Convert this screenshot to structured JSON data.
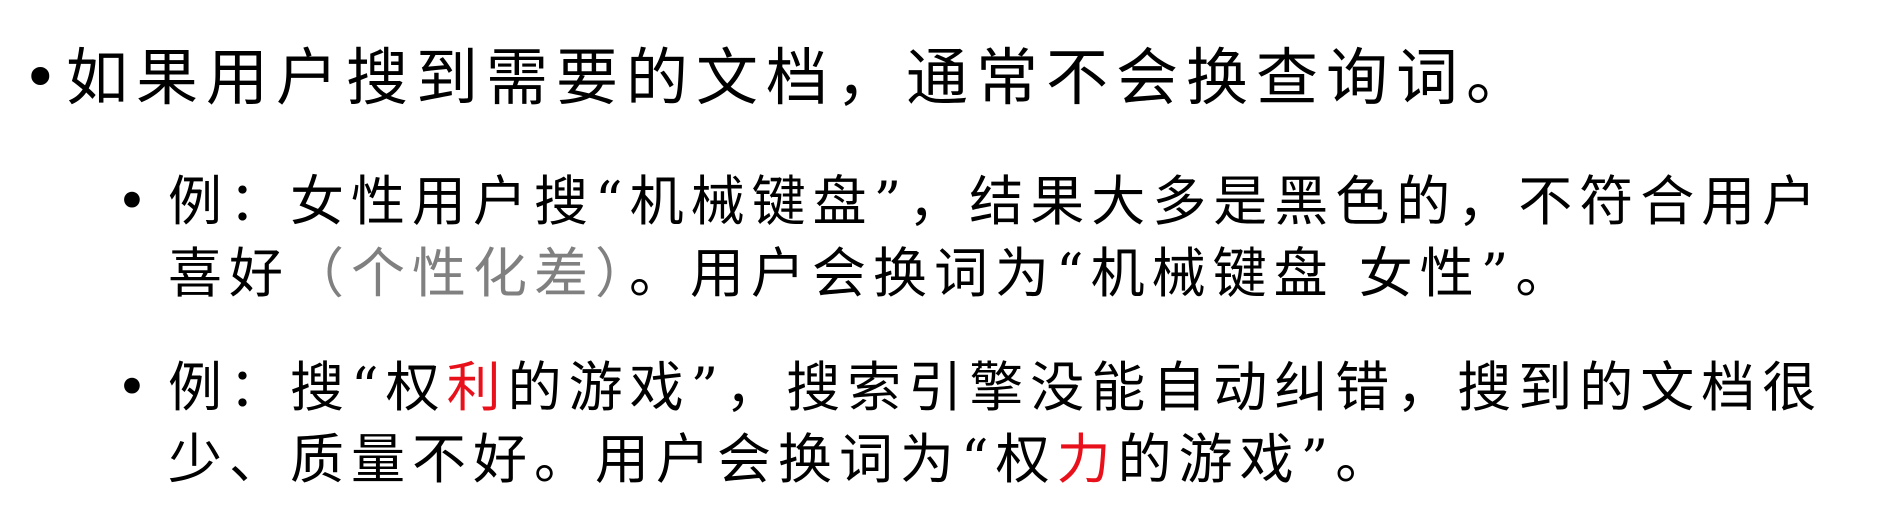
{
  "main_point": "如果用户搜到需要的文档，通常不会换查询词。",
  "examples": [
    {
      "part1": "例：女性用户搜“机械键盘”，结果大多是黑色的，不符合用户喜好",
      "muted": "（个性化差）",
      "part2": "。用户会换词为“机械键盘 女性”。"
    },
    {
      "part1": "例：搜“权",
      "highlight1": "利",
      "part2": "的游戏”，搜索引擎没能自动纠错，搜到的文档很少、质量不好。用户会换词为“权",
      "highlight2": "力",
      "part3": "的游戏”。"
    }
  ],
  "colors": {
    "text": "#000000",
    "muted": "#808080",
    "highlight": "#e8101a"
  },
  "bullet_glyph": "•"
}
